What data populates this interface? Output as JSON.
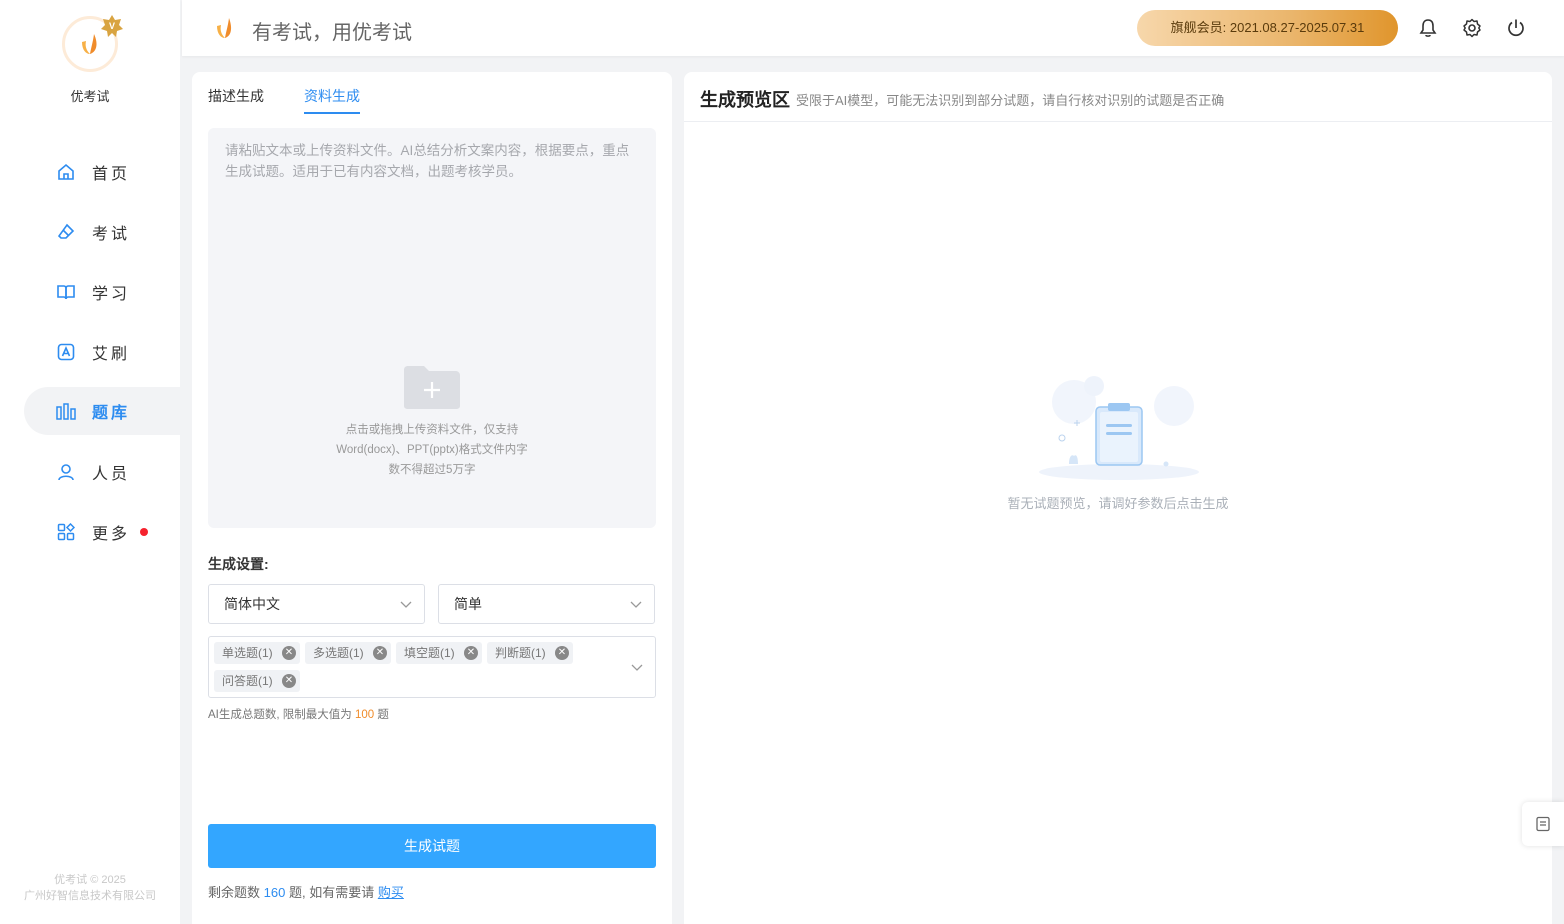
{
  "app": {
    "brand_name": "优考试",
    "slogan": "有考试，用优考试"
  },
  "sidebar": {
    "items": [
      {
        "label": "首页",
        "icon": "home-icon"
      },
      {
        "label": "考试",
        "icon": "eraser-icon"
      },
      {
        "label": "学习",
        "icon": "book-icon"
      },
      {
        "label": "艾刷",
        "icon": "letter-a-icon"
      },
      {
        "label": "题库",
        "icon": "bars-icon",
        "active": true
      },
      {
        "label": "人员",
        "icon": "user-icon"
      },
      {
        "label": "更多",
        "icon": "apps-icon",
        "dot": true
      }
    ],
    "footer": {
      "copyright": "优考试 © 2025",
      "company": "广州好智信息技术有限公司"
    }
  },
  "header": {
    "vip_label": "旗舰会员: 2021.08.27-2025.07.31",
    "icons": [
      "bell-icon",
      "gear-icon",
      "power-icon"
    ]
  },
  "left_panel": {
    "tabs": [
      {
        "label": "描述生成",
        "active": false
      },
      {
        "label": "资料生成",
        "active": true
      }
    ],
    "upload": {
      "placeholder": "请粘贴文本或上传资料文件。AI总结分析文案内容，根据要点，重点生成试题。适用于已有内容文档，出题考核学员。",
      "hint_line1": "点击或拖拽上传资料文件，仅支持",
      "hint_line2": "Word(docx)、PPT(pptx)格式文件内字",
      "hint_line3": "数不得超过5万字"
    },
    "settings_title": "生成设置:",
    "language_select": "简体中文",
    "difficulty_select": "简单",
    "question_types": [
      "单选题(1)",
      "多选题(1)",
      "填空题(1)",
      "判断题(1)",
      "问答题(1)"
    ],
    "limit_note": {
      "prefix": "AI生成总题数, 限制最大值为",
      "value": "100",
      "suffix": "题"
    },
    "generate_button": "生成试题",
    "remaining": {
      "prefix": "剩余题数",
      "value": "160",
      "middle": "题, 如有需要请",
      "link": "购买"
    }
  },
  "right_panel": {
    "title": "生成预览区",
    "subtitle": "受限于AI模型，可能无法识别到部分试题，请自行核对识别的试题是否正确",
    "empty_text": "暂无试题预览，请调好参数后点击生成"
  },
  "colors": {
    "accent": "#2d8cf0",
    "button": "#33a6ff",
    "vip_start": "#f7d7ab",
    "vip_end": "#e0952c",
    "dot": "#f5222d"
  }
}
